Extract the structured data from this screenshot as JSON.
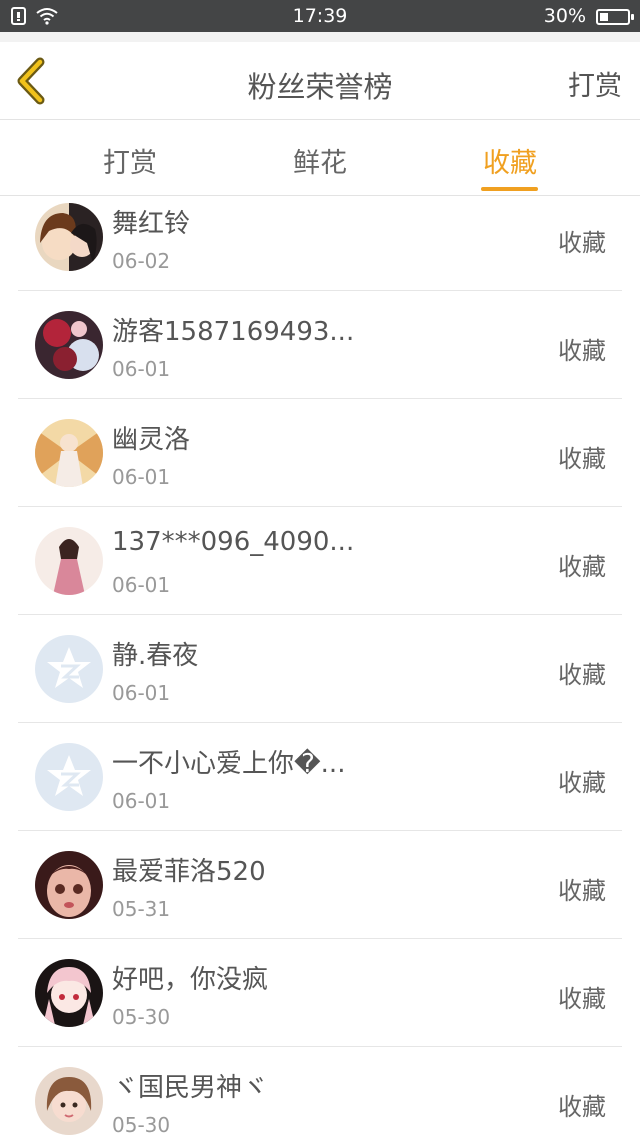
{
  "status_bar": {
    "time": "17:39",
    "battery_text": "30%",
    "battery_level": 0.3,
    "icons": [
      "sim-icon",
      "wifi-icon",
      "battery-icon"
    ]
  },
  "nav": {
    "back_icon": "chevron-left-icon",
    "title": "粉丝荣誉榜",
    "right_link": "打赏"
  },
  "colors": {
    "accent": "#f0a020",
    "status_bar_bg": "#444546",
    "default_avatar": "#dfe8f2"
  },
  "tabs": [
    {
      "label": "打赏",
      "active": false
    },
    {
      "label": "鲜花",
      "active": false
    },
    {
      "label": "收藏",
      "active": true
    }
  ],
  "list": [
    {
      "name": "舞红铃",
      "date": "06-02",
      "action": "收藏",
      "avatar": "anime-pair-avatar"
    },
    {
      "name": "游客1587169493...",
      "date": "06-01",
      "action": "收藏",
      "avatar": "red-flower-avatar"
    },
    {
      "name": "幽灵洛",
      "date": "06-01",
      "action": "收藏",
      "avatar": "golden-wings-avatar"
    },
    {
      "name": "137***096_4090...",
      "date": "06-01",
      "action": "收藏",
      "avatar": "girl-pink-avatar"
    },
    {
      "name": "静.春夜",
      "date": "06-01",
      "action": "收藏",
      "avatar": "qzone-default-avatar"
    },
    {
      "name": "一不小心爱上你�...",
      "date": "06-01",
      "action": "收藏",
      "avatar": "qzone-default-avatar"
    },
    {
      "name": "最爱菲洛520",
      "date": "05-31",
      "action": "收藏",
      "avatar": "doll-face-avatar"
    },
    {
      "name": "好吧，你没疯",
      "date": "05-30",
      "action": "收藏",
      "avatar": "anime-pink-hair-avatar"
    },
    {
      "name": "ヾ国民男神ヾ",
      "date": "05-30",
      "action": "收藏",
      "avatar": "girl-photo-avatar"
    }
  ]
}
